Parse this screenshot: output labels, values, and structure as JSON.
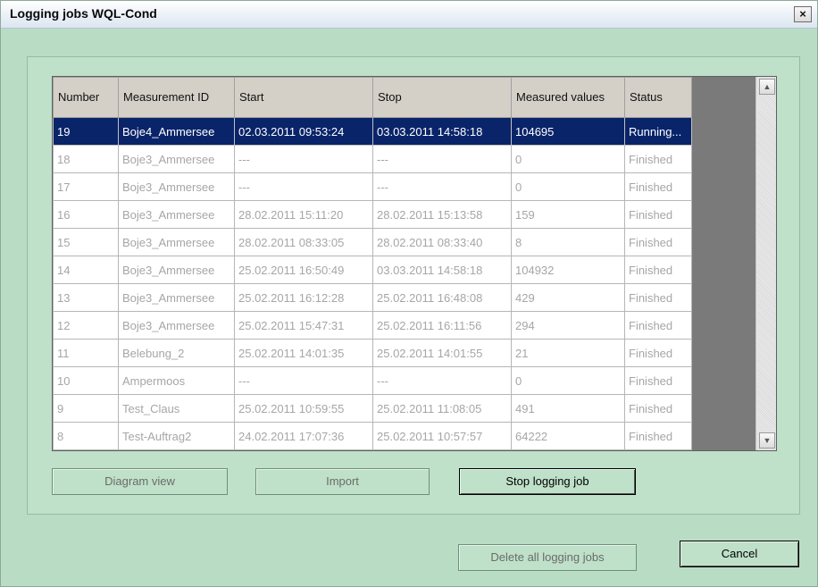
{
  "window": {
    "title": "Logging jobs WQL-Cond",
    "close_label": "×"
  },
  "table": {
    "columns": [
      "Number",
      "Measurement ID",
      "Start",
      "Stop",
      "Measured values",
      "Status"
    ],
    "rows": [
      [
        "19",
        "Boje4_Ammersee",
        "02.03.2011 09:53:24",
        "03.03.2011 14:58:18",
        "104695",
        "Running..."
      ],
      [
        "18",
        "Boje3_Ammersee",
        "---",
        "---",
        "0",
        "Finished"
      ],
      [
        "17",
        "Boje3_Ammersee",
        "---",
        "---",
        "0",
        "Finished"
      ],
      [
        "16",
        "Boje3_Ammersee",
        "28.02.2011 15:11:20",
        "28.02.2011 15:13:58",
        "159",
        "Finished"
      ],
      [
        "15",
        "Boje3_Ammersee",
        "28.02.2011 08:33:05",
        "28.02.2011 08:33:40",
        "8",
        "Finished"
      ],
      [
        "14",
        "Boje3_Ammersee",
        "25.02.2011 16:50:49",
        "03.03.2011 14:58:18",
        "104932",
        "Finished"
      ],
      [
        "13",
        "Boje3_Ammersee",
        "25.02.2011 16:12:28",
        "25.02.2011 16:48:08",
        "429",
        "Finished"
      ],
      [
        "12",
        "Boje3_Ammersee",
        "25.02.2011 15:47:31",
        "25.02.2011 16:11:56",
        "294",
        "Finished"
      ],
      [
        "11",
        "Belebung_2",
        "25.02.2011 14:01:35",
        "25.02.2011 14:01:55",
        "21",
        "Finished"
      ],
      [
        "10",
        "Ampermoos",
        "---",
        "---",
        "0",
        "Finished"
      ],
      [
        "9",
        "Test_Claus",
        "25.02.2011 10:59:55",
        "25.02.2011 11:08:05",
        "491",
        "Finished"
      ],
      [
        "8",
        "Test-Auftrag2",
        "24.02.2011 17:07:36",
        "25.02.2011 10:57:57",
        "64222",
        "Finished"
      ]
    ],
    "selected_row": 0
  },
  "buttons": {
    "diagram_view": "Diagram view",
    "import": "Import",
    "stop_logging": "Stop logging job",
    "delete_all": "Delete all logging jobs",
    "cancel": "Cancel"
  }
}
